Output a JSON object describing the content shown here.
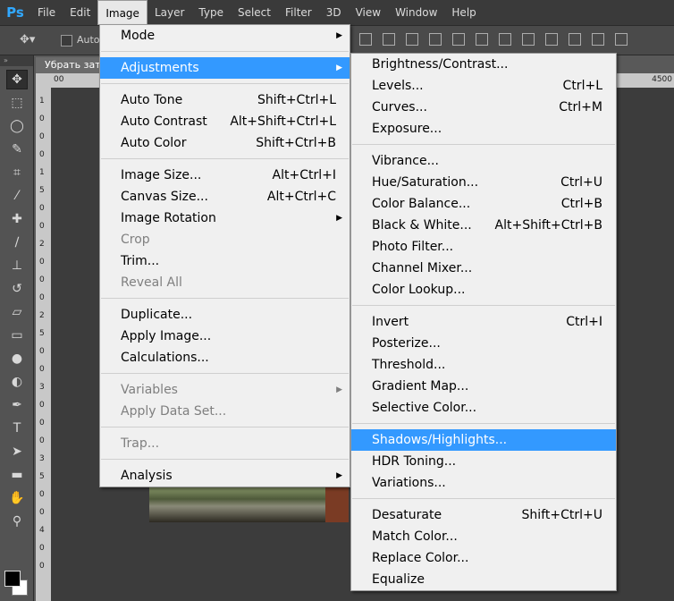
{
  "app": {
    "logo": "Ps",
    "brand_color": "#31a8ff"
  },
  "menubar": [
    {
      "label": "File",
      "active": false
    },
    {
      "label": "Edit",
      "active": false
    },
    {
      "label": "Image",
      "active": true
    },
    {
      "label": "Layer",
      "active": false
    },
    {
      "label": "Type",
      "active": false
    },
    {
      "label": "Select",
      "active": false
    },
    {
      "label": "Filter",
      "active": false
    },
    {
      "label": "3D",
      "active": false
    },
    {
      "label": "View",
      "active": false
    },
    {
      "label": "Window",
      "active": false
    },
    {
      "label": "Help",
      "active": false
    }
  ],
  "options": {
    "auto_label": "Auto"
  },
  "toolbar": {
    "header": "»",
    "tools": [
      "move-tool-icon",
      "marquee-tool-icon",
      "lasso-tool-icon",
      "quick-select-tool-icon",
      "crop-tool-icon",
      "eyedropper-tool-icon",
      "healing-brush-icon",
      "brush-tool-icon",
      "clone-stamp-icon",
      "history-brush-icon",
      "eraser-tool-icon",
      "gradient-tool-icon",
      "blur-tool-icon",
      "dodge-tool-icon",
      "pen-tool-icon",
      "type-tool-icon",
      "path-select-icon",
      "shape-tool-icon",
      "hand-tool-icon",
      "zoom-tool-icon"
    ]
  },
  "document": {
    "tab_title": "Убрать затемнение",
    "ruler_top_left": "00",
    "ruler_top_right": "4500",
    "ruler_left_digits": [
      "1",
      "0",
      "0",
      "0",
      "1",
      "5",
      "0",
      "0",
      "2",
      "0",
      "0",
      "0",
      "2",
      "5",
      "0",
      "0",
      "3",
      "0",
      "0",
      "0",
      "3",
      "5",
      "0",
      "0",
      "4",
      "0",
      "0"
    ]
  },
  "image_menu": [
    {
      "label": "Mode",
      "submenu": true
    },
    {
      "sep": true
    },
    {
      "label": "Adjustments",
      "submenu": true,
      "highlight": true
    },
    {
      "sep": true
    },
    {
      "label": "Auto Tone",
      "shortcut": "Shift+Ctrl+L"
    },
    {
      "label": "Auto Contrast",
      "shortcut": "Alt+Shift+Ctrl+L"
    },
    {
      "label": "Auto Color",
      "shortcut": "Shift+Ctrl+B"
    },
    {
      "sep": true
    },
    {
      "label": "Image Size...",
      "shortcut": "Alt+Ctrl+I"
    },
    {
      "label": "Canvas Size...",
      "shortcut": "Alt+Ctrl+C"
    },
    {
      "label": "Image Rotation",
      "submenu": true
    },
    {
      "label": "Crop",
      "disabled": true
    },
    {
      "label": "Trim..."
    },
    {
      "label": "Reveal All",
      "disabled": true
    },
    {
      "sep": true
    },
    {
      "label": "Duplicate..."
    },
    {
      "label": "Apply Image..."
    },
    {
      "label": "Calculations..."
    },
    {
      "sep": true
    },
    {
      "label": "Variables",
      "submenu": true,
      "disabled": true
    },
    {
      "label": "Apply Data Set...",
      "disabled": true
    },
    {
      "sep": true
    },
    {
      "label": "Trap...",
      "disabled": true
    },
    {
      "sep": true
    },
    {
      "label": "Analysis",
      "submenu": true
    }
  ],
  "adjustments_menu": [
    {
      "label": "Brightness/Contrast..."
    },
    {
      "label": "Levels...",
      "shortcut": "Ctrl+L"
    },
    {
      "label": "Curves...",
      "shortcut": "Ctrl+M"
    },
    {
      "label": "Exposure..."
    },
    {
      "sep": true
    },
    {
      "label": "Vibrance..."
    },
    {
      "label": "Hue/Saturation...",
      "shortcut": "Ctrl+U"
    },
    {
      "label": "Color Balance...",
      "shortcut": "Ctrl+B"
    },
    {
      "label": "Black & White...",
      "shortcut": "Alt+Shift+Ctrl+B"
    },
    {
      "label": "Photo Filter..."
    },
    {
      "label": "Channel Mixer..."
    },
    {
      "label": "Color Lookup..."
    },
    {
      "sep": true
    },
    {
      "label": "Invert",
      "shortcut": "Ctrl+I"
    },
    {
      "label": "Posterize..."
    },
    {
      "label": "Threshold..."
    },
    {
      "label": "Gradient Map..."
    },
    {
      "label": "Selective Color..."
    },
    {
      "sep": true
    },
    {
      "label": "Shadows/Highlights...",
      "highlight": true
    },
    {
      "label": "HDR Toning..."
    },
    {
      "label": "Variations..."
    },
    {
      "sep": true
    },
    {
      "label": "Desaturate",
      "shortcut": "Shift+Ctrl+U"
    },
    {
      "label": "Match Color..."
    },
    {
      "label": "Replace Color..."
    },
    {
      "label": "Equalize"
    }
  ]
}
